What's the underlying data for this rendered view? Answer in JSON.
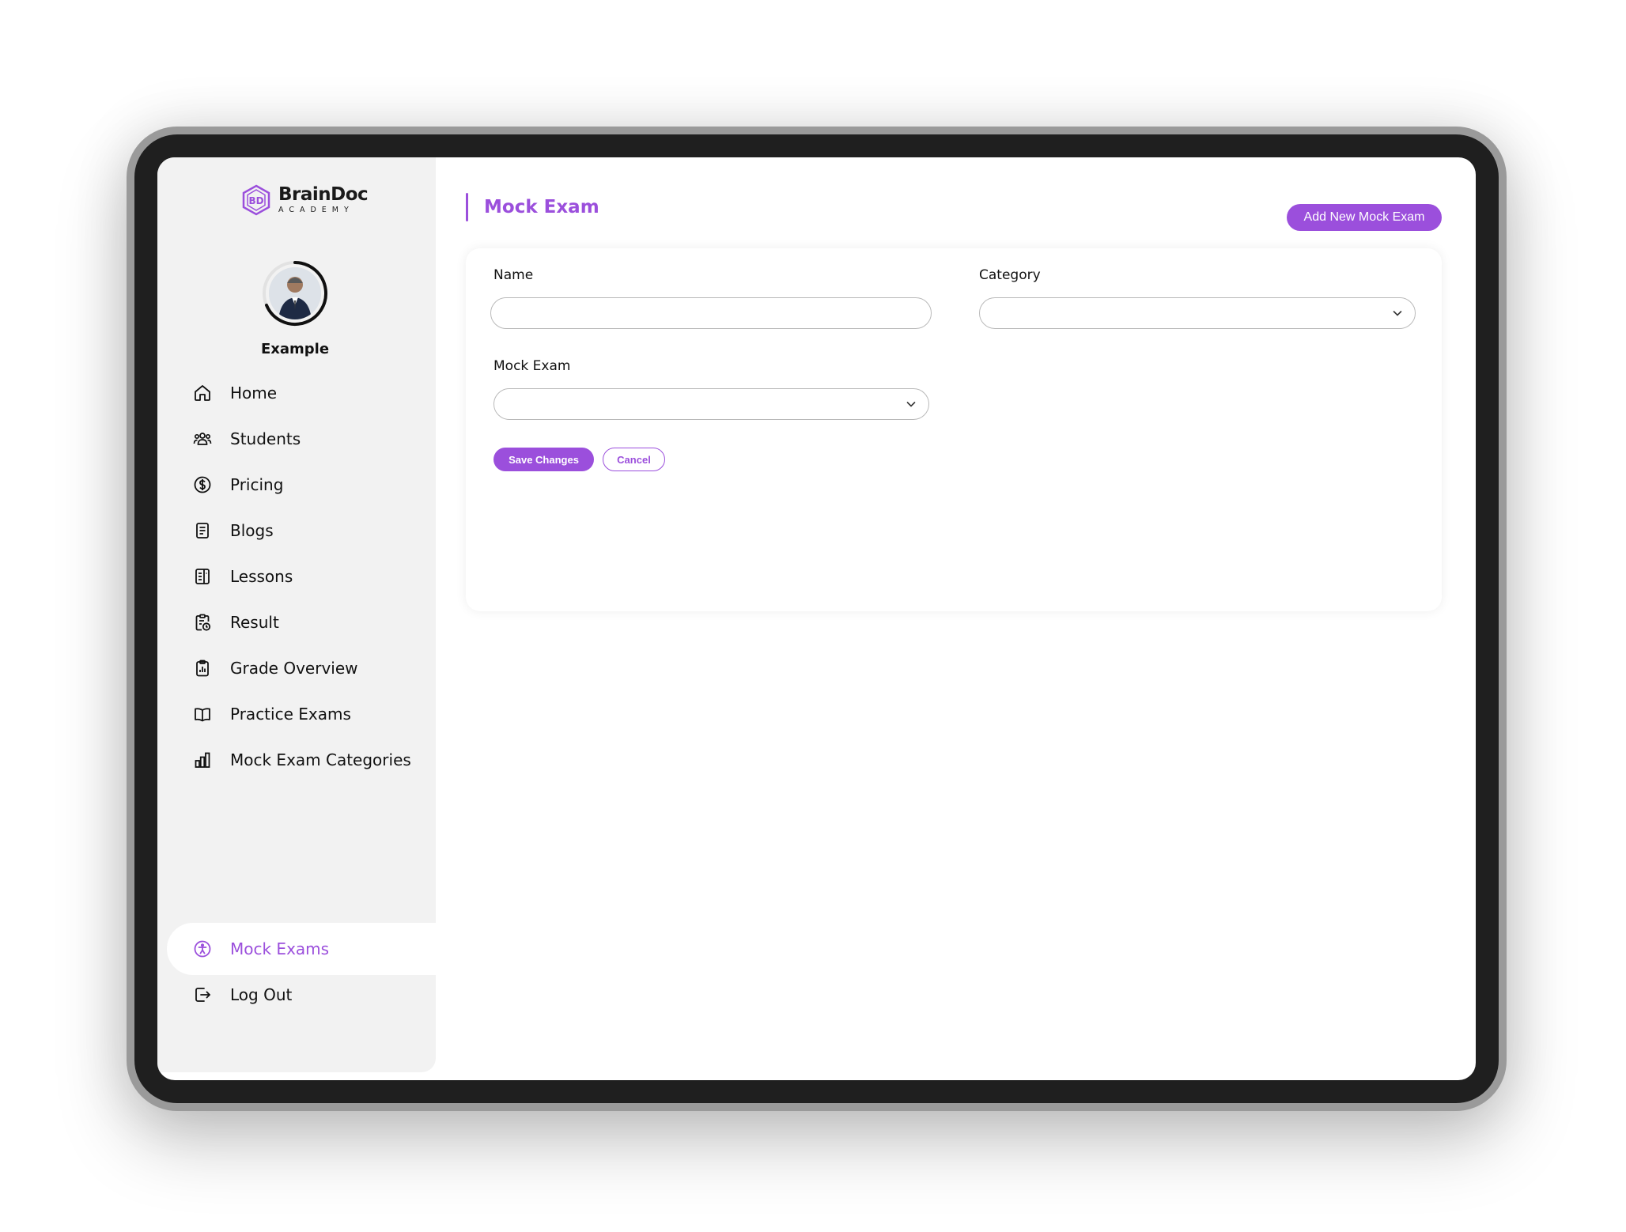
{
  "brand": {
    "name": "BrainDoc",
    "subtitle": "ACADEMY",
    "logo_text": "BD"
  },
  "user": {
    "name": "Example"
  },
  "sidebar": {
    "items": [
      {
        "label": "Home",
        "icon": "home-icon"
      },
      {
        "label": "Students",
        "icon": "users-icon"
      },
      {
        "label": "Pricing",
        "icon": "dollar-circle-icon"
      },
      {
        "label": "Blogs",
        "icon": "document-icon"
      },
      {
        "label": "Lessons",
        "icon": "book-list-icon"
      },
      {
        "label": "Result",
        "icon": "clipboard-clock-icon"
      },
      {
        "label": "Grade Overview",
        "icon": "clipboard-chart-icon"
      },
      {
        "label": "Practice Exams",
        "icon": "open-book-icon"
      },
      {
        "label": "Mock Exam Categories",
        "icon": "bar-chart-icon"
      },
      {
        "label": "Mock Exams",
        "icon": "accessibility-icon",
        "active": true
      },
      {
        "label": "Log Out",
        "icon": "logout-icon"
      }
    ]
  },
  "header": {
    "title": "Mock Exam",
    "add_button": "Add New Mock Exam"
  },
  "form": {
    "name_label": "Name",
    "name_value": "",
    "category_label": "Category",
    "category_value": "",
    "mock_exam_label": "Mock Exam",
    "mock_exam_value": "",
    "save_label": "Save Changes",
    "cancel_label": "Cancel"
  },
  "colors": {
    "accent": "#9b4fdc",
    "sidebar_bg": "#f2f2f2",
    "device_frame": "#1f1f1f"
  }
}
